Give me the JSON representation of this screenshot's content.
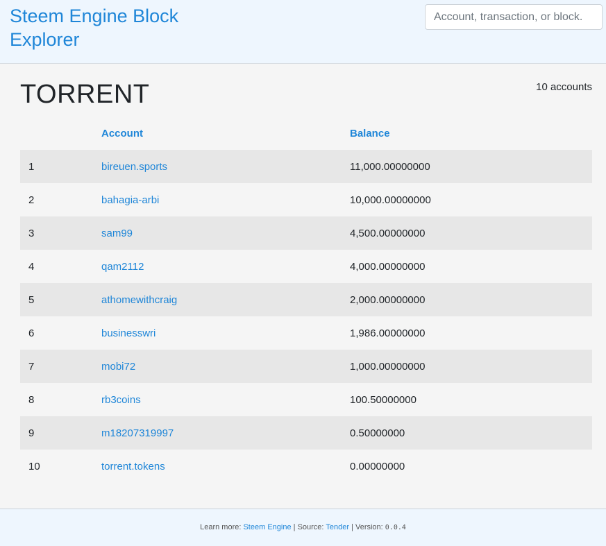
{
  "header": {
    "brand": "Steem Engine Block Explorer",
    "search_placeholder": "Account, transaction, or block."
  },
  "token": {
    "symbol": "TORRENT",
    "account_count": "10 accounts"
  },
  "table": {
    "columns": [
      "",
      "Account",
      "Balance"
    ],
    "rows": [
      {
        "rank": "1",
        "account": "bireuen.sports",
        "balance": "11,000.00000000"
      },
      {
        "rank": "2",
        "account": "bahagia-arbi",
        "balance": "10,000.00000000"
      },
      {
        "rank": "3",
        "account": "sam99",
        "balance": "4,500.00000000"
      },
      {
        "rank": "4",
        "account": "qam2112",
        "balance": "4,000.00000000"
      },
      {
        "rank": "5",
        "account": "athomewithcraig",
        "balance": "2,000.00000000"
      },
      {
        "rank": "6",
        "account": "businesswri",
        "balance": "1,986.00000000"
      },
      {
        "rank": "7",
        "account": "mobi72",
        "balance": "1,000.00000000"
      },
      {
        "rank": "8",
        "account": "rb3coins",
        "balance": "100.50000000"
      },
      {
        "rank": "9",
        "account": "m18207319997",
        "balance": "0.50000000"
      },
      {
        "rank": "10",
        "account": "torrent.tokens",
        "balance": "0.00000000"
      }
    ]
  },
  "footer": {
    "learn_more": "Learn more:",
    "steem_engine_link": "Steem Engine",
    "sep1": "|",
    "source": "Source:",
    "tender_link": "Tender",
    "sep2": "|",
    "version_label": "Version:",
    "version": "0.0.4"
  },
  "colors": {
    "accent": "#1f86d8",
    "header_bg": "#eef6fe",
    "page_bg": "#f5f5f5",
    "stripe": "#e7e7e7"
  }
}
